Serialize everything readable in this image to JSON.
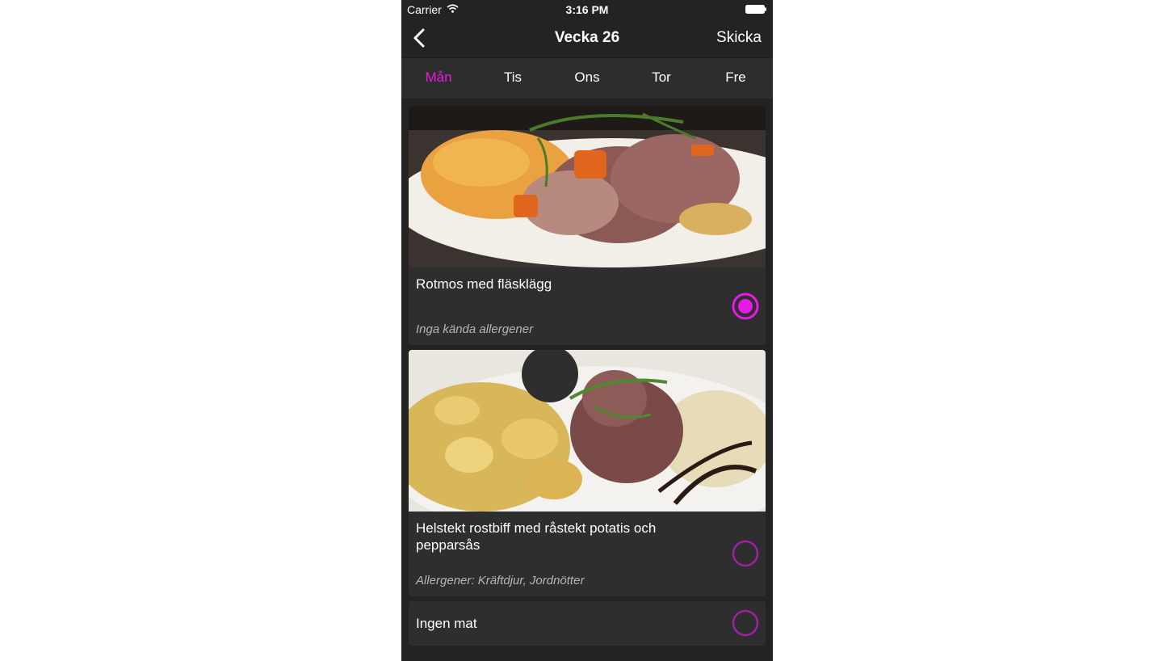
{
  "status": {
    "carrier": "Carrier",
    "time": "3:16 PM"
  },
  "nav": {
    "title": "Vecka 26",
    "send_label": "Skicka"
  },
  "tabs": [
    "Mån",
    "Tis",
    "Ons",
    "Tor",
    "Fre"
  ],
  "active_tab": "Mån",
  "accent_color": "#e61ae6",
  "meals": [
    {
      "name": "Rotmos med fläsklägg",
      "allergens": "Inga kända allergener",
      "selected": true
    },
    {
      "name": "Helstekt rostbiff med råstekt potatis och pepparsås",
      "allergens": "Allergener: Kräftdjur, Jordnötter",
      "selected": false
    },
    {
      "name": "Ingen mat",
      "selected": false
    }
  ]
}
